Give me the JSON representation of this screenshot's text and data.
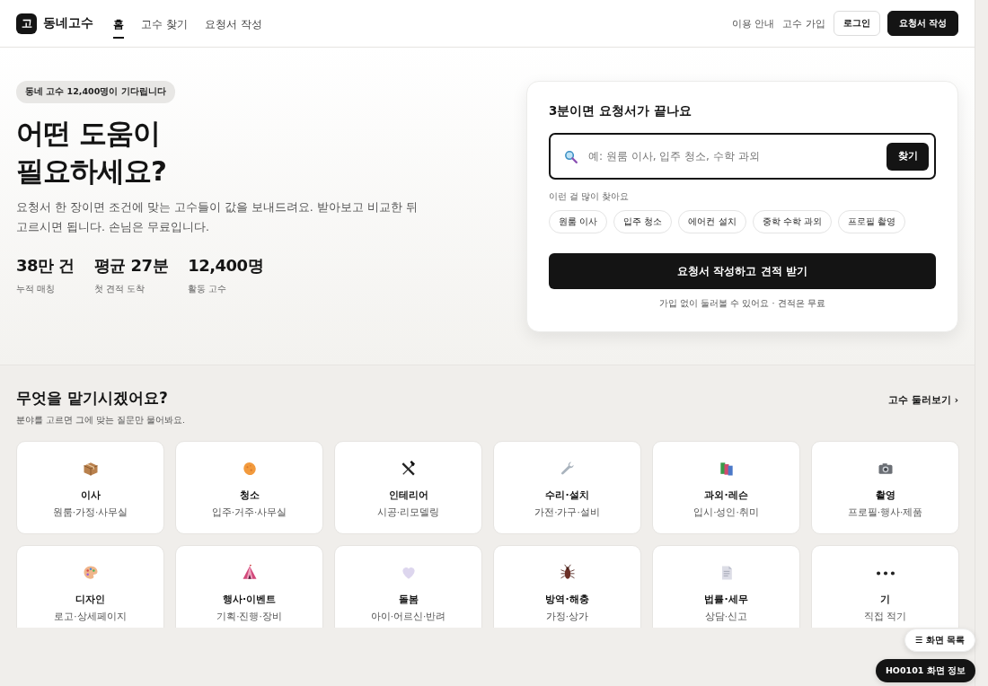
{
  "header": {
    "logo": {
      "mark": "고",
      "name": "동네고수"
    },
    "nav": [
      {
        "label": "홈",
        "selected": true
      },
      {
        "label": "고수 찾기",
        "selected": false
      },
      {
        "label": "요청서 작성",
        "selected": false
      }
    ],
    "links": [
      "이용 안내",
      "고수 가입"
    ],
    "buttons": [
      {
        "label": "로그인",
        "kind": "outline"
      },
      {
        "label": "요청서 작성",
        "kind": "primary"
      }
    ]
  },
  "hero": {
    "badge": "동네 고수 12,400명이 기다립니다",
    "title": [
      "어떤 도움이",
      "필요하세요?"
    ],
    "description": "요청서 한 장이면 조건에 맞는 고수들이 값을 보내드려요. 받아보고 비교한 뒤 고르시면 됩니다. 손님은 무료입니다.",
    "stats": [
      {
        "value": "38만 건",
        "label": "누적 매칭"
      },
      {
        "value": "평균 27분",
        "label": "첫 견적 도착"
      },
      {
        "value": "12,400명",
        "label": "활동 고수"
      }
    ]
  },
  "request_card": {
    "title": "3분이면 요청서가 끝나요",
    "search": {
      "placeholder": "예: 원룸 이사, 입주 청소, 수학 과외",
      "button": "찾기"
    },
    "popular_label": "이런 걸 많이 찾아요",
    "chips": [
      "원룸 이사",
      "입주 청소",
      "에어컨 설치",
      "중학 수학 과외",
      "프로필 촬영"
    ],
    "submit": "요청서 작성하고 견적 받기",
    "note": "가입 없이 둘러볼 수 있어요 · 견적은 무료"
  },
  "categories": {
    "title": "무엇을 맡기시겠어요?",
    "subtitle": "분야를 고르면 그에 맞는 질문만 물어봐요.",
    "link": "고수 둘러보기 ›",
    "items": [
      {
        "title": "이사",
        "subtitle": "원룸·가정·사무실"
      },
      {
        "title": "청소",
        "subtitle": "입주·거주·사무실"
      },
      {
        "title": "인테리어",
        "subtitle": "시공·리모델링"
      },
      {
        "title": "수리·설치",
        "subtitle": "가전·가구·설비"
      },
      {
        "title": "과외·레슨",
        "subtitle": "입시·성인·취미"
      },
      {
        "title": "촬영",
        "subtitle": "프로필·행사·제품"
      },
      {
        "title": "디자인",
        "subtitle": "로고·상세페이지"
      },
      {
        "title": "행사·이벤트",
        "subtitle": "기획·진행·장비"
      },
      {
        "title": "돌봄",
        "subtitle": "아이·어르신·반려"
      },
      {
        "title": "방역·해충",
        "subtitle": "가정·상가"
      },
      {
        "title": "법률·세무",
        "subtitle": "상담·신고"
      },
      {
        "title": "기",
        "subtitle": "직접 적기"
      }
    ]
  },
  "overlay": {
    "buttons": [
      {
        "label": "☰ 화면 목록",
        "kind": "light"
      },
      {
        "label": "HO0101 화면 정보",
        "kind": "dark"
      }
    ]
  }
}
